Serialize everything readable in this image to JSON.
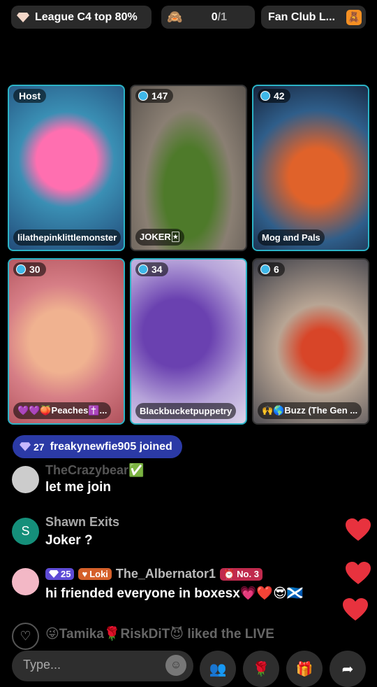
{
  "top_bar": {
    "league_label": "League C4 top 80%",
    "counter_value": "0",
    "counter_total": "/1",
    "fan_club_label": "Fan Club L..."
  },
  "tiles": [
    {
      "badge": "Host",
      "name": "lilathepinklittlemonster"
    },
    {
      "badge": "147",
      "name": "JOKER🃏"
    },
    {
      "badge": "42",
      "name": "Mog and Pals"
    },
    {
      "badge": "30",
      "name": "💜💜🍑Peaches✝️..."
    },
    {
      "badge": "34",
      "name": "Blackbucketpuppetry"
    },
    {
      "badge": "6",
      "name": "🙌🌎Buzz (The Gen ..."
    }
  ],
  "joined": {
    "level": "27",
    "text": "freakynewfie905 joined"
  },
  "messages": [
    {
      "user": "TheCrazybear✅",
      "text": "let me join"
    },
    {
      "avatar_letter": "S",
      "user": "Shawn Exits",
      "text": "Joker ?"
    },
    {
      "level": "25",
      "fan_tag": "Loki",
      "user": "The_Albernator1",
      "rank": "No. 3",
      "text": "hi friended everyone in boxesx💗❤️😎🏴󠁧󠁢󠁳󠁣󠁴󠁿"
    },
    {
      "text": "😜Tamika🌹RiskDiT😈 liked the LIVE"
    }
  ],
  "input": {
    "placeholder": "Type..."
  },
  "colors": {
    "tile_border": "#2bb3c6",
    "joined_bg": "#2b3aa6",
    "heart": "#e8323e"
  }
}
